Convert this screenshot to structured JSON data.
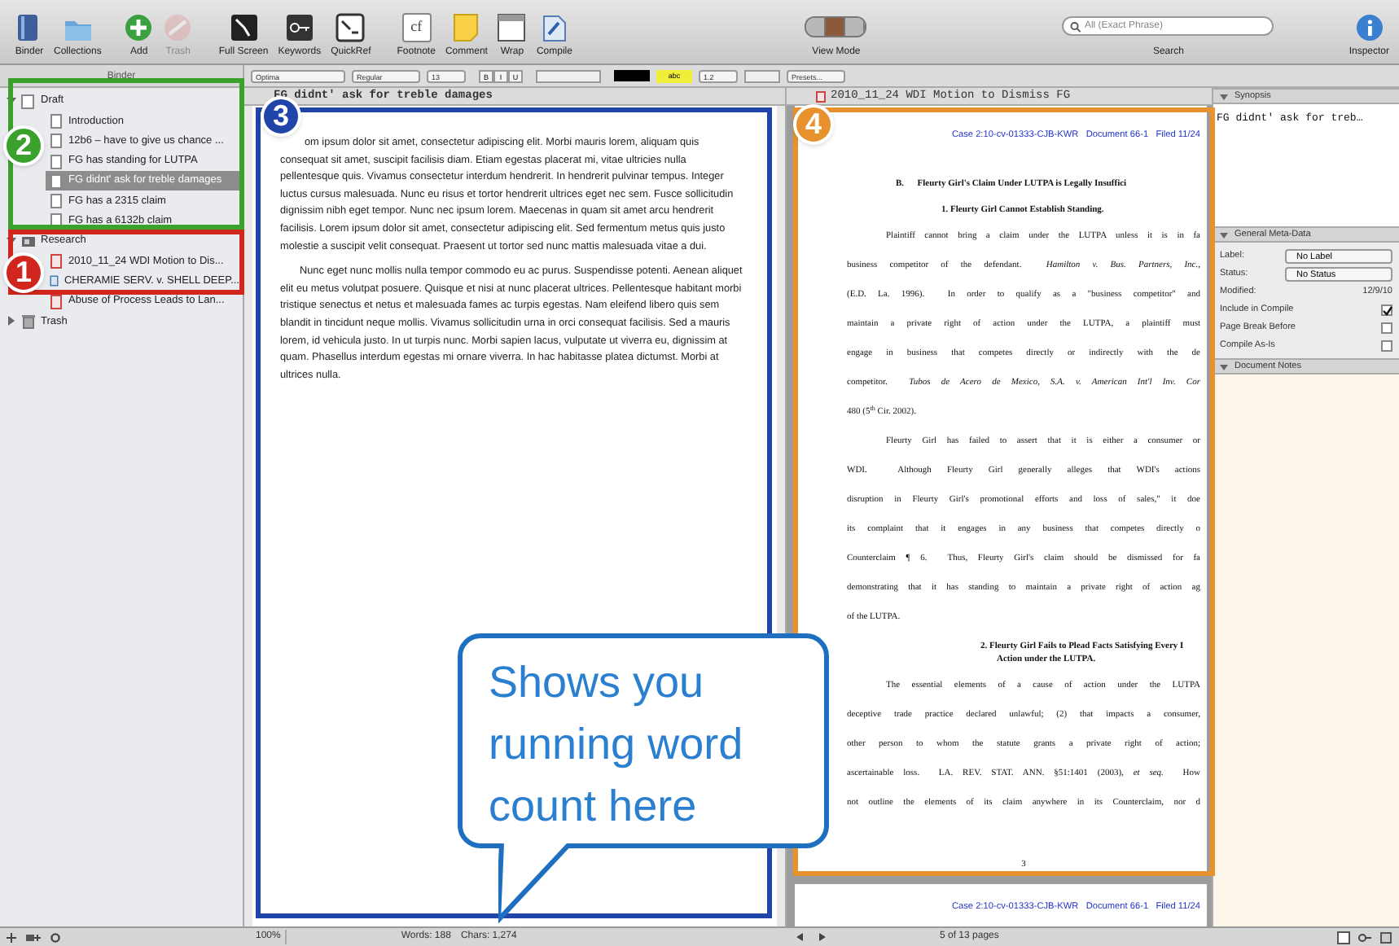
{
  "toolbar": {
    "items": [
      {
        "label": "Binder",
        "disabled": false
      },
      {
        "label": "Collections",
        "disabled": false
      },
      {
        "label": "Add",
        "disabled": false
      },
      {
        "label": "Trash",
        "disabled": true
      },
      {
        "label": "Full Screen",
        "disabled": false
      },
      {
        "label": "Keywords",
        "disabled": false
      },
      {
        "label": "QuickRef",
        "disabled": false
      },
      {
        "label": "Footnote",
        "disabled": false,
        "glyph": "cf"
      },
      {
        "label": "Comment",
        "disabled": false
      },
      {
        "label": "Wrap",
        "disabled": false
      },
      {
        "label": "Compile",
        "disabled": false
      }
    ],
    "view_mode": {
      "label": "View Mode",
      "segments": [
        {
          "selected": false
        },
        {
          "selected": true
        },
        {
          "selected": false
        }
      ]
    },
    "search": {
      "placeholder": "All (Exact Phrase)",
      "label": "Search"
    },
    "inspector": {
      "label": "Inspector"
    }
  },
  "format_bar": {
    "font": "Optima",
    "style": "Regular",
    "size": "13",
    "styles": [
      "B",
      "I",
      "U"
    ],
    "highlight": "abc",
    "line_spacing": "1.2",
    "presets": "Presets..."
  },
  "binder": {
    "title": "Binder",
    "items": [
      {
        "label": "Draft",
        "kind": "draft",
        "expanded": true,
        "selected": false,
        "children": [
          {
            "label": "Introduction",
            "kind": "text",
            "selected": false
          },
          {
            "label": "12b6 – have to give us chance ...",
            "kind": "text",
            "selected": false
          },
          {
            "label": "FG has standing for LUTPA",
            "kind": "text",
            "selected": false
          },
          {
            "label": "FG didnt' ask for treble damages",
            "kind": "text",
            "selected": true
          },
          {
            "label": "FG has a 2315 claim",
            "kind": "text",
            "selected": false
          },
          {
            "label": "FG has a 6132b claim",
            "kind": "text",
            "selected": false
          }
        ]
      },
      {
        "label": "Research",
        "kind": "research",
        "expanded": true,
        "selected": false,
        "children": [
          {
            "label": "2010_11_24 WDI Motion to Dis...",
            "kind": "pdf",
            "selected": false
          },
          {
            "label": "CHERAMIE SERV. v. SHELL DEEP...",
            "kind": "web",
            "selected": false
          },
          {
            "label": "Abuse of Process Leads to Lan...",
            "kind": "pdf",
            "selected": false
          }
        ]
      },
      {
        "label": "Trash",
        "kind": "trash",
        "expanded": false,
        "selected": false
      }
    ]
  },
  "editor": {
    "title": "FG didnt' ask for treble damages",
    "paragraphs": [
      "om ipsum dolor sit amet, consectetur adipiscing elit. Morbi mauris lorem, aliquam quis consequat sit amet, suscipit facilisis diam. Etiam egestas placerat mi, vitae ultricies nulla pellentesque quis. Vivamus consectetur interdum hendrerit. In hendrerit pulvinar tempus. Integer luctus cursus malesuada. Nunc eu risus et tortor hendrerit ultrices eget nec sem. Fusce sollicitudin dignissim nibh eget tempor. Nunc nec ipsum lorem. Maecenas in quam sit amet arcu hendrerit facilisis. Lorem ipsum dolor sit amet, consectetur adipiscing elit. Sed fermentum metus quis justo molestie a suscipit velit consequat. Praesent ut tortor sed nunc mattis malesuada vitae a dui.",
      "Nunc eget nunc mollis nulla tempor commodo eu ac purus. Suspendisse potenti. Aenean aliquet elit eu metus volutpat posuere. Quisque et nisi at nunc placerat ultrices. Pellentesque habitant morbi tristique senectus et netus et malesuada fames ac turpis egestas. Nam eleifend libero quis sem blandit in tincidunt neque mollis. Vivamus sollicitudin urna in orci consequat facilisis. Sed a mauris lorem, id vehicula justo. In ut turpis nunc. Morbi sapien lacus, vulputate ut viverra eu, dignissim at quam. Phasellus interdum egestas mi ornare viverra. In hac habitasse platea dictumst. Morbi at ultrices nulla."
    ],
    "zoom": "100%",
    "word_count": "Words: 188",
    "char_count": "Chars: 1,274"
  },
  "document": {
    "title": "2010_11_24 WDI Motion to Dismiss FG",
    "page_header": "Case 2:10-cv-01333-CJB-KWR   Document 66-1   Filed 11/24",
    "lines": [
      {
        "kind": "heading",
        "text": "B.      Fleurty Girl's Claim Under LUTPA is Legally Insuffici"
      },
      {
        "kind": "subheading",
        "text": "1.  Fleurty Girl Cannot Establish Standing."
      },
      {
        "kind": "first",
        "text": "Plaintiff cannot bring a claim under the LUTPA unless it is in fa"
      },
      {
        "kind": "body",
        "text": "business competitor of the defendant.  *Hamilton v. Bus. Partners, Inc.*,"
      },
      {
        "kind": "body",
        "text": "(E.D. La. 1996).  In order to qualify as a \"business competitor\" and"
      },
      {
        "kind": "body",
        "text": "maintain a private right of action under the LUTPA, a plaintiff must"
      },
      {
        "kind": "body",
        "text": "engage in business that competes directly or indirectly with the de"
      },
      {
        "kind": "body",
        "text": "competitor.  *Tubos de Acero de Mexico, S.A. v. American Int'l Inv. Cor*"
      },
      {
        "kind": "end",
        "text": "480 (5$^{th}$ Cir. 2002)."
      },
      {
        "kind": "first",
        "text": "Fleurty Girl has failed to assert that it is either a consumer or"
      },
      {
        "kind": "body",
        "text": "WDI.  Although Fleurty Girl generally alleges that WDI's actions"
      },
      {
        "kind": "body",
        "text": "disruption in Fleurty Girl's promotional efforts and loss of sales,\" it doe"
      },
      {
        "kind": "body",
        "text": "its complaint that it engages in any business that competes directly o"
      },
      {
        "kind": "body",
        "text": "Counterclaim ¶ 6.  Thus, Fleurty Girl's claim should be dismissed for fa"
      },
      {
        "kind": "body",
        "text": "demonstrating that it has standing to maintain a private right of action ag"
      },
      {
        "kind": "end",
        "text": "of the LUTPA."
      },
      {
        "kind": "heading2",
        "text": "2.  Fleurty Girl Fails to Plead Facts Satisfying Every I"
      },
      {
        "kind": "heading2b",
        "text": "Action under the LUTPA."
      },
      {
        "kind": "first",
        "text": "The essential elements of a cause of action under the LUTPA"
      },
      {
        "kind": "body",
        "text": "deceptive trade practice declared unlawful; (2) that impacts a consumer,"
      },
      {
        "kind": "body",
        "text": "other person to whom the statute grants a private right of action;"
      },
      {
        "kind": "body",
        "text": "ascertainable loss.  LA. REV. STAT. ANN. §51:1401 (2003), *et seq.*  How"
      },
      {
        "kind": "body",
        "text": "not outline the elements of its claim anywhere in its Counterclaim, nor d"
      }
    ],
    "page_number": "3",
    "next_page_header": "Case 2:10-cv-01333-CJB-KWR   Document 66-1   Filed 11/24",
    "page_count": "5 of 13 pages"
  },
  "inspector": {
    "synopsis_title": "Synopsis",
    "synopsis": "FG didnt' ask for treb…",
    "meta_title": "General Meta-Data",
    "meta": [
      {
        "kind": "select",
        "label": "Label:",
        "value": "No Label"
      },
      {
        "kind": "select",
        "label": "Status:",
        "value": "No Status"
      },
      {
        "kind": "date",
        "label": "Modified:",
        "value": "12/9/10"
      },
      {
        "kind": "checkbox",
        "label": "Include in Compile",
        "checked": true
      },
      {
        "kind": "checkbox",
        "label": "Page Break Before",
        "checked": false
      },
      {
        "kind": "checkbox",
        "label": "Compile As-Is",
        "checked": false
      }
    ],
    "notes_title": "Document Notes"
  },
  "annotations": {
    "markers": [
      {
        "number": "2",
        "color": "#3aa12c"
      },
      {
        "number": "1",
        "color": "#d0261d"
      },
      {
        "number": "3",
        "color": "#2044a8"
      },
      {
        "number": "4",
        "color": "#e8922e"
      }
    ],
    "callout": "Shows you running word count here"
  }
}
